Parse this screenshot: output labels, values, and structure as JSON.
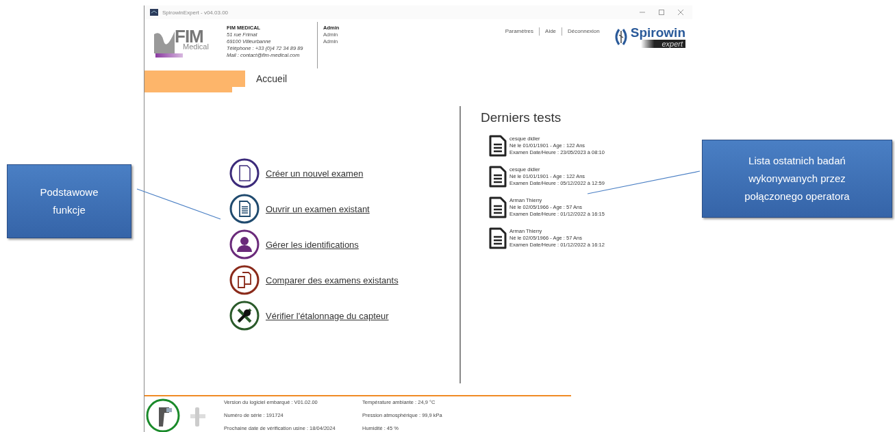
{
  "window": {
    "title": "SpirowinExpert - v04.03.00"
  },
  "header": {
    "logo": {
      "name": "FIM",
      "sub": "Medical"
    },
    "company": [
      "FIM MEDICAL",
      "51 rue Frimat",
      "69100 Villeurbanne",
      "Téléphone : +33 (0)4 72 34 89 89",
      "Mail : contact@fim-medical.com"
    ],
    "user": [
      "Admin",
      "Admin",
      "Admin"
    ],
    "links": [
      "Paramètres",
      "Aide",
      "Déconnexion"
    ],
    "brand": {
      "name": "Spirowin",
      "sub": "expert"
    }
  },
  "tabs": [
    {
      "label": "Accueil",
      "selected": true
    }
  ],
  "actions": [
    {
      "label": "Créer un nouvel examen",
      "kind": "new",
      "color": "#3b2a7a"
    },
    {
      "label": "Ouvrir un examen existant",
      "kind": "open",
      "color": "#1f4a6e"
    },
    {
      "label": "Gérer les identifications",
      "kind": "user",
      "color": "#6a2a7a"
    },
    {
      "label": "Comparer des examens existants",
      "kind": "compare",
      "color": "#8a2a1a"
    },
    {
      "label": "Vérifier l'étalonnage du capteur",
      "kind": "calibrate",
      "color": "#2a5a2a"
    }
  ],
  "recent": {
    "title": "Derniers tests",
    "tests": [
      {
        "name": "cesque didier",
        "born": "Né le 01/01/1901 - Age : 122 Ans",
        "exam": "Examen Date/Heure : 23/05/2023 à 08:10"
      },
      {
        "name": "cesque didier",
        "born": "Né le 01/01/1901 - Age : 122 Ans",
        "exam": "Examen Date/Heure : 05/12/2022 à 12:59"
      },
      {
        "name": "Arman Thierry",
        "born": "Né le 02/05/1966 - Age : 57 Ans",
        "exam": "Examen Date/Heure : 01/12/2022 à 16:15"
      },
      {
        "name": "Arman Thierry",
        "born": "Né le 02/05/1966 - Age : 57 Ans",
        "exam": "Examen Date/Heure : 01/12/2022 à 16:12"
      }
    ]
  },
  "status_bar": {
    "device_info": [
      "Version du logiciel embarqué : V01.02.00",
      "Numéro de série : 191724",
      "Prochaine date de vérification usine : 18/04/2024"
    ],
    "environment": [
      "Température ambiante : 24,9 °C",
      "Pression atmosphérique : 99,9 kPa",
      "Humidité : 45 %"
    ]
  },
  "callouts": [
    {
      "text": "Podstawowe funkcje"
    },
    {
      "text": "Lista ostatnich badań wykonywanych przez połączonego operatora"
    }
  ]
}
